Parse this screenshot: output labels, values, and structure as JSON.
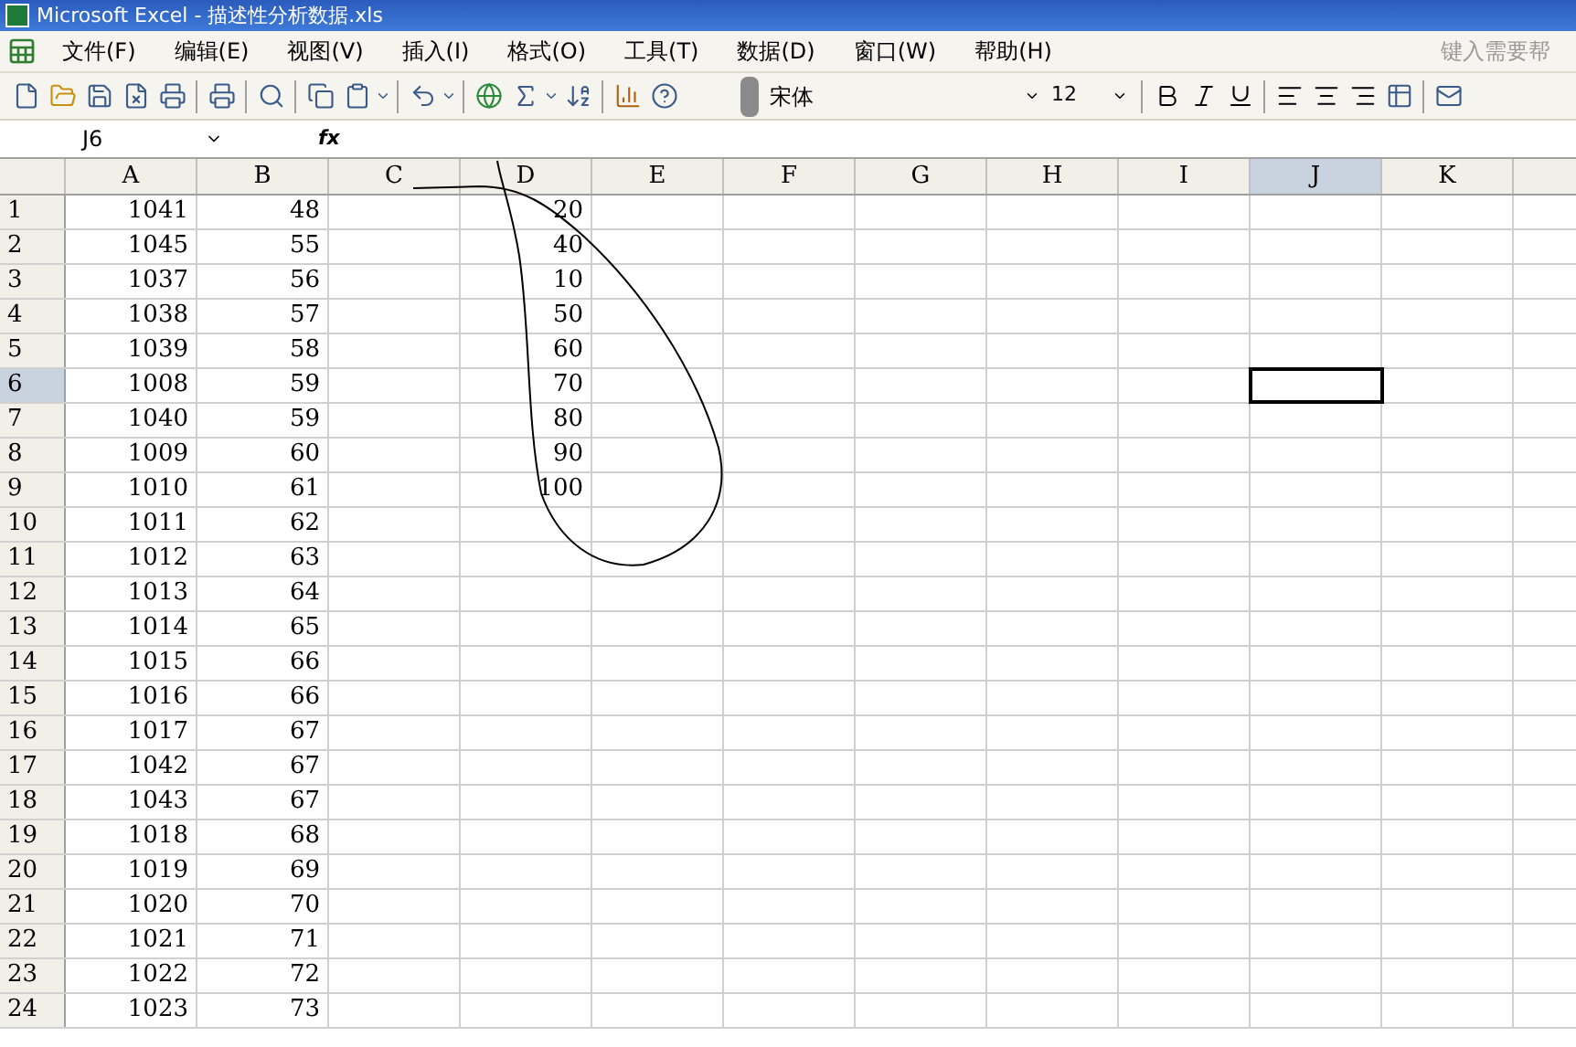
{
  "window": {
    "title": "Microsoft Excel - 描述性分析数据.xls"
  },
  "menu": [
    "文件(F)",
    "编辑(E)",
    "视图(V)",
    "插入(I)",
    "格式(O)",
    "工具(T)",
    "数据(D)",
    "窗口(W)",
    "帮助(H)"
  ],
  "help_box": {
    "placeholder": "键入需要帮"
  },
  "font": {
    "name": "宋体",
    "size": "12"
  },
  "name_box": {
    "value": "J6"
  },
  "formula_bar": {
    "label": "fx"
  },
  "columns": [
    {
      "label": "A",
      "selected": false
    },
    {
      "label": "B",
      "selected": false
    },
    {
      "label": "C",
      "selected": false
    },
    {
      "label": "D",
      "selected": false
    },
    {
      "label": "E",
      "selected": false
    },
    {
      "label": "F",
      "selected": false
    },
    {
      "label": "G",
      "selected": false
    },
    {
      "label": "H",
      "selected": false
    },
    {
      "label": "I",
      "selected": false
    },
    {
      "label": "J",
      "selected": true
    },
    {
      "label": "K",
      "selected": false
    }
  ],
  "rows": [
    {
      "number": "1",
      "selected": false,
      "cells": {
        "A": "1041",
        "B": "48",
        "D": "20"
      }
    },
    {
      "number": "2",
      "selected": false,
      "cells": {
        "A": "1045",
        "B": "55",
        "D": "40"
      }
    },
    {
      "number": "3",
      "selected": false,
      "cells": {
        "A": "1037",
        "B": "56",
        "D": "10"
      }
    },
    {
      "number": "4",
      "selected": false,
      "cells": {
        "A": "1038",
        "B": "57",
        "D": "50"
      }
    },
    {
      "number": "5",
      "selected": false,
      "cells": {
        "A": "1039",
        "B": "58",
        "D": "60"
      }
    },
    {
      "number": "6",
      "selected": true,
      "cells": {
        "A": "1008",
        "B": "59",
        "D": "70"
      }
    },
    {
      "number": "7",
      "selected": false,
      "cells": {
        "A": "1040",
        "B": "59",
        "D": "80"
      }
    },
    {
      "number": "8",
      "selected": false,
      "cells": {
        "A": "1009",
        "B": "60",
        "D": "90"
      }
    },
    {
      "number": "9",
      "selected": false,
      "cells": {
        "A": "1010",
        "B": "61",
        "D": "100"
      }
    },
    {
      "number": "10",
      "selected": false,
      "cells": {
        "A": "1011",
        "B": "62"
      }
    },
    {
      "number": "11",
      "selected": false,
      "cells": {
        "A": "1012",
        "B": "63"
      }
    },
    {
      "number": "12",
      "selected": false,
      "cells": {
        "A": "1013",
        "B": "64"
      }
    },
    {
      "number": "13",
      "selected": false,
      "cells": {
        "A": "1014",
        "B": "65"
      }
    },
    {
      "number": "14",
      "selected": false,
      "cells": {
        "A": "1015",
        "B": "66"
      }
    },
    {
      "number": "15",
      "selected": false,
      "cells": {
        "A": "1016",
        "B": "66"
      }
    },
    {
      "number": "16",
      "selected": false,
      "cells": {
        "A": "1017",
        "B": "67"
      }
    },
    {
      "number": "17",
      "selected": false,
      "cells": {
        "A": "1042",
        "B": "67"
      }
    },
    {
      "number": "18",
      "selected": false,
      "cells": {
        "A": "1043",
        "B": "67"
      }
    },
    {
      "number": "19",
      "selected": false,
      "cells": {
        "A": "1018",
        "B": "68"
      }
    },
    {
      "number": "20",
      "selected": false,
      "cells": {
        "A": "1019",
        "B": "69"
      }
    },
    {
      "number": "21",
      "selected": false,
      "cells": {
        "A": "1020",
        "B": "70"
      }
    },
    {
      "number": "22",
      "selected": false,
      "cells": {
        "A": "1021",
        "B": "71"
      }
    },
    {
      "number": "23",
      "selected": false,
      "cells": {
        "A": "1022",
        "B": "72"
      }
    },
    {
      "number": "24",
      "selected": false,
      "cells": {
        "A": "1023",
        "B": "73"
      }
    }
  ]
}
